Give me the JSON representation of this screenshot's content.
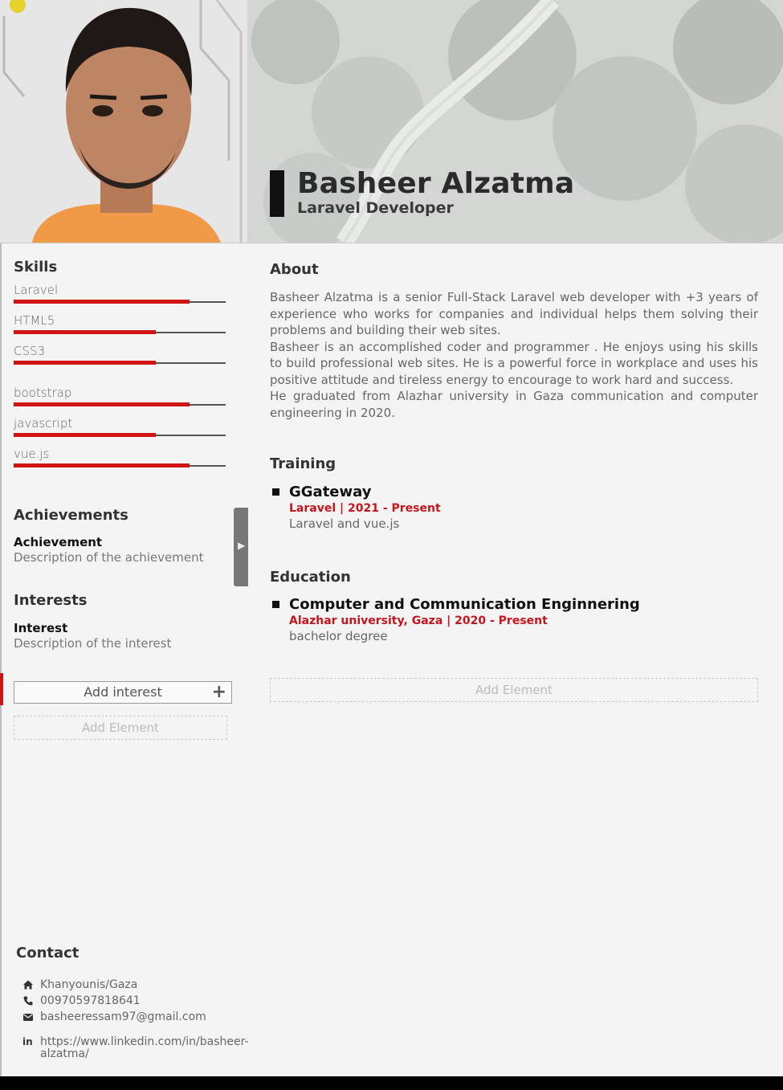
{
  "header": {
    "name": "Basheer Alzatma",
    "title": "Laravel Developer"
  },
  "skills": {
    "heading": "Skills",
    "items": [
      {
        "label": "Laravel",
        "level": 0.83
      },
      {
        "label": "HTML5",
        "level": 0.67
      },
      {
        "label": "CSS3",
        "level": 0.67
      },
      {
        "label": "bootstrap",
        "level": 0.83
      },
      {
        "label": "javascript",
        "level": 0.67
      },
      {
        "label": "vue.js",
        "level": 0.83
      }
    ]
  },
  "achievements": {
    "heading": "Achievements",
    "item_title": "Achievement",
    "item_desc": "Description of the achievement"
  },
  "interests": {
    "heading": "Interests",
    "item_title": "Interest",
    "item_desc": "Description of the interest",
    "add_label": "Add interest",
    "add_icon": "+"
  },
  "left_add_element": "Add Element",
  "about": {
    "heading": "About",
    "paragraphs": [
      "Basheer Alzatma is a senior Full-Stack Laravel web developer with +3 years of experience who works for companies and individual helps them solving their problems and building their web sites.",
      "Basheer is an accomplished coder and programmer . He enjoys using his skills to build professional web sites. He is a powerful force in workplace and uses his positive attitude and tireless energy to encourage to work hard and success.",
      "He graduated from Alazhar university in Gaza communication and computer engineering in 2020."
    ]
  },
  "training": {
    "heading": "Training",
    "title": "GGateway",
    "sub": "Laravel  | 2021 - Present",
    "desc": "Laravel and vue.js"
  },
  "education": {
    "heading": "Education",
    "title": "Computer and Communication Enginnering",
    "sub": "Alazhar university, Gaza | 2020 - Present",
    "desc": "bachelor degree"
  },
  "right_add_element": "Add Element",
  "contact": {
    "heading": "Contact",
    "location": "Khanyounis/Gaza",
    "phone": "00970597818641",
    "email": "basheeressam97@gmail.com",
    "linkedin_line1": "https://www.linkedin.com/in/basheer-",
    "linkedin_line2": "alzatma/"
  },
  "colors": {
    "accent": "#d01414",
    "text": "#333333",
    "bar_bottom": "#000000"
  }
}
